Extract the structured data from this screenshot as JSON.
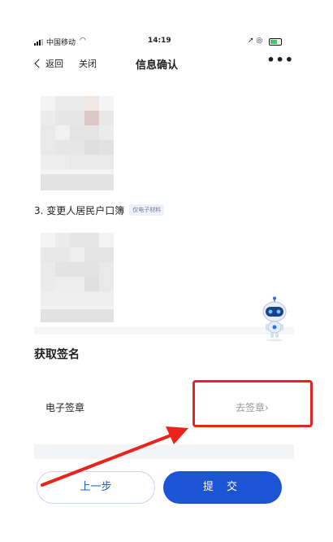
{
  "status_bar": {
    "carrier": "中国移动",
    "time": "14:19"
  },
  "nav": {
    "back_label": "返回",
    "close_label": "关闭",
    "title": "信息确认",
    "more_label": "•••"
  },
  "section3": {
    "title": "3. 变更人居民户口簿",
    "badge": "仅电子材料"
  },
  "signature": {
    "title": "获取签名",
    "row_label": "电子签章",
    "action_label": "去签章›"
  },
  "footer": {
    "prev_label": "上一步",
    "submit_label": "提 交"
  },
  "colors": {
    "primary": "#1b55d4",
    "highlight": "#e8241c"
  }
}
